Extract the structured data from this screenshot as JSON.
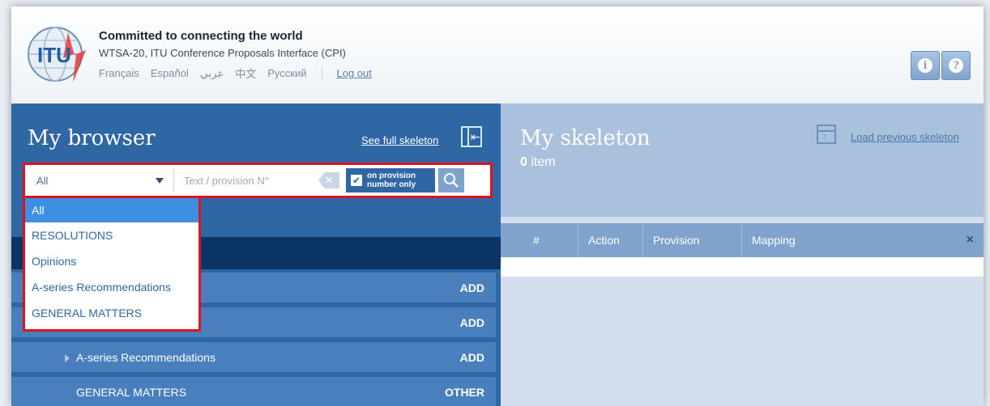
{
  "header": {
    "tagline": "Committed to connecting the world",
    "subtitle": "WTSA-20, ITU Conference Proposals Interface (CPI)",
    "languages": [
      "Français",
      "Español",
      "عربي",
      "中文",
      "Русский"
    ],
    "logout": "Log out",
    "logo_text": "ITU",
    "info_icon": "info-icon",
    "help_icon": "help-icon"
  },
  "browser": {
    "title": "My browser",
    "see_full_skeleton": "See full skeleton",
    "search": {
      "select_value": "All",
      "text_placeholder": "Text / provision N°",
      "checkbox_label_line1": "on provision",
      "checkbox_label_line2": "number only",
      "checkbox_checked": true
    },
    "dropdown_options": [
      "All",
      "RESOLUTIONS",
      "Opinions",
      "A-series Recommendations",
      "GENERAL MATTERS"
    ],
    "rows": [
      {
        "name": "",
        "action": "ADD"
      },
      {
        "name": "",
        "action": "ADD"
      },
      {
        "name": "A-series Recommendations",
        "action": "ADD"
      },
      {
        "name": "GENERAL MATTERS",
        "action": "OTHER"
      }
    ]
  },
  "skeleton": {
    "title": "My skeleton",
    "count": "0",
    "count_label": "item",
    "load_previous": "Load previous skeleton",
    "columns": [
      "#",
      "Action",
      "Provision",
      "Mapping"
    ],
    "close": "×"
  },
  "colors": {
    "left_panel": "#2f67a4",
    "right_panel_top": "#a9c1dc",
    "highlight_border": "#e0121e",
    "dropdown_active": "#3d8fe2"
  }
}
